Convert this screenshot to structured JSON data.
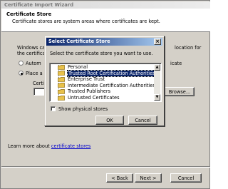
{
  "wizard": {
    "title": "Certificate Import Wizard",
    "header_title": "Certificate Store",
    "header_subtitle": "Certificate stores are system areas where certificates are kept.",
    "body_line1_left": "Windows can",
    "body_line1_right": "location for",
    "body_line2_left": "the certificat",
    "option_auto_label": "Autom",
    "option_auto_right": "icate",
    "option_place_label": "Place a",
    "cert_store_label": "Certifi",
    "browse_label": "Browse...",
    "learn_more_text": "Learn more about",
    "learn_more_link": "certificate stores",
    "back_label": "< Back",
    "next_label": "Next >",
    "cancel_label": "Cancel"
  },
  "dialog": {
    "title": "Select Certificate Store",
    "prompt": "Select the certificate store you want to use.",
    "stores": [
      "Personal",
      "Trusted Root Certification Authorities",
      "Enterprise Trust",
      "Intermediate Certification Authorities",
      "Trusted Publishers",
      "Untrusted Certificates"
    ],
    "selected_store": "Trusted Root Certification Authorities",
    "show_physical_label": "Show physical stores",
    "show_physical_checked": false,
    "ok_label": "OK",
    "cancel_label": "Cancel",
    "close_glyph": "×"
  },
  "colors": {
    "title_active": "#0a246a",
    "face": "#d4d0c8",
    "link": "#0000cc",
    "folder": "#e8c14a"
  }
}
